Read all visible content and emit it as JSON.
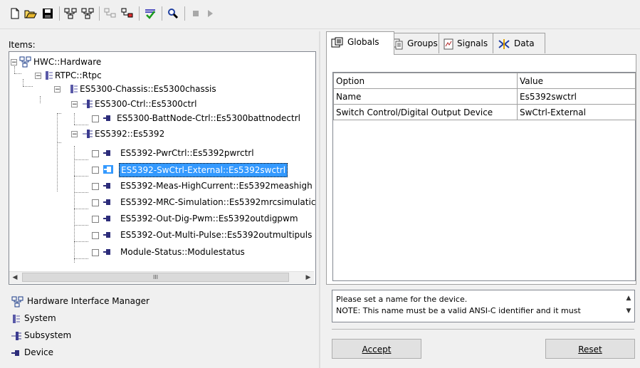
{
  "toolbar": {
    "buttons": [
      "new-icon",
      "open-icon",
      "save-icon",
      "hierarchy-icon",
      "hierarchy-alt-icon",
      "disabled-tool-icon",
      "add-module-icon",
      "check-icon",
      "search-icon",
      "stop-icon",
      "play-icon"
    ]
  },
  "left": {
    "items_label": "Items:",
    "tree": [
      {
        "label": "HWC::Hardware"
      },
      {
        "label": "RTPC::Rtpc"
      },
      {
        "label": "ES5300-Chassis::Es5300chassis"
      },
      {
        "label": "ES5300-Ctrl::Es5300ctrl"
      },
      {
        "label": "ES5300-BattNode-Ctrl::Es5300battnodectrl"
      },
      {
        "label": "ES5392::Es5392"
      },
      {
        "label": "ES5392-PwrCtrl::Es5392pwrctrl"
      },
      {
        "label": "ES5392-SwCtrl-External::Es5392swctrl"
      },
      {
        "label": "ES5392-Meas-HighCurrent::Es5392meashigh"
      },
      {
        "label": "ES5392-MRC-Simulation::Es5392mrcsimulatic"
      },
      {
        "label": "ES5392-Out-Dig-Pwm::Es5392outdigpwm"
      },
      {
        "label": "ES5392-Out-Multi-Pulse::Es5392outmultipuls"
      },
      {
        "label": "Module-Status::Modulestatus"
      }
    ],
    "scroll_grip": "III",
    "legend": [
      {
        "label": "Hardware Interface Manager"
      },
      {
        "label": "System"
      },
      {
        "label": "Subsystem"
      },
      {
        "label": "Device"
      }
    ]
  },
  "right": {
    "tabs": [
      {
        "label": "Globals"
      },
      {
        "label": "Groups"
      },
      {
        "label": "Signals"
      },
      {
        "label": "Data"
      }
    ],
    "table": {
      "headers": [
        "Option",
        "Value"
      ],
      "rows": [
        [
          "Name",
          "Es5392swctrl"
        ],
        [
          "Switch Control/Digital Output Device",
          "SwCtrl-External"
        ]
      ]
    },
    "description": {
      "line1": "Please set a name for the device.",
      "line2": "NOTE: This name must be a valid ANSI-C identifier and it must"
    },
    "accept_label": "Accept",
    "reset_label": "Reset"
  },
  "colors": {
    "selection": "#3399ff",
    "device_icon": "#2c2c7a",
    "system_icon": "#5a5aa8"
  }
}
